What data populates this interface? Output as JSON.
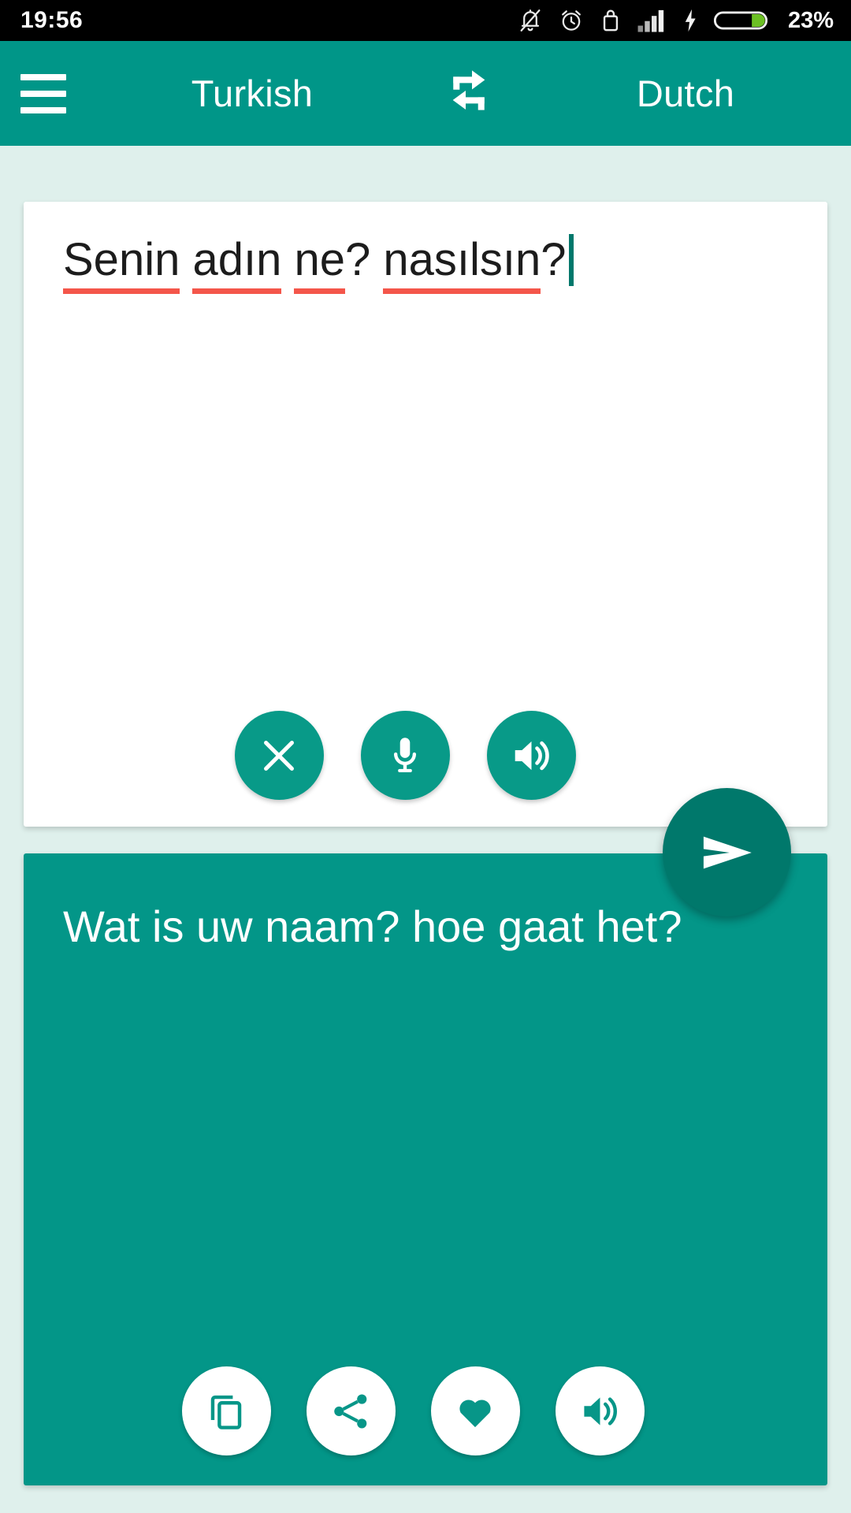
{
  "status_bar": {
    "time": "19:56",
    "battery_percent": "23%",
    "icons": [
      "notifications-off-icon",
      "alarm-icon",
      "screen-lock-icon",
      "signal-bars-icon",
      "charging-bolt-icon",
      "battery-icon"
    ]
  },
  "toolbar": {
    "menu_icon": "hamburger-menu-icon",
    "source_language": "Turkish",
    "swap_icon": "swap-languages-icon",
    "target_language": "Dutch"
  },
  "source_panel": {
    "text": "Senin adın ne? nasılsın?",
    "words": [
      "Senin",
      "adın",
      "ne",
      "nasılsın"
    ],
    "misspelled_underline_color": "#f4564a",
    "caret_visible": true,
    "actions": [
      {
        "name": "clear-button",
        "icon": "close-icon",
        "label": "Clear"
      },
      {
        "name": "voice-input-button",
        "icon": "microphone-icon",
        "label": "Speak"
      },
      {
        "name": "speak-source-button",
        "icon": "volume-up-icon",
        "label": "Listen"
      }
    ]
  },
  "send_button": {
    "icon": "send-icon",
    "label": "Translate"
  },
  "target_panel": {
    "text": "Wat is uw naam? hoe gaat het?",
    "actions": [
      {
        "name": "copy-button",
        "icon": "copy-icon",
        "label": "Copy"
      },
      {
        "name": "share-button",
        "icon": "share-icon",
        "label": "Share"
      },
      {
        "name": "favorite-button",
        "icon": "heart-icon",
        "label": "Favorite"
      },
      {
        "name": "speak-target-button",
        "icon": "volume-up-icon",
        "label": "Listen"
      }
    ]
  },
  "colors": {
    "primary": "#009688",
    "primary_dark": "#00786b",
    "background": "#dff0ec",
    "card_white": "#ffffff",
    "accent_red": "#f4564a",
    "battery_green": "#6cc024"
  }
}
